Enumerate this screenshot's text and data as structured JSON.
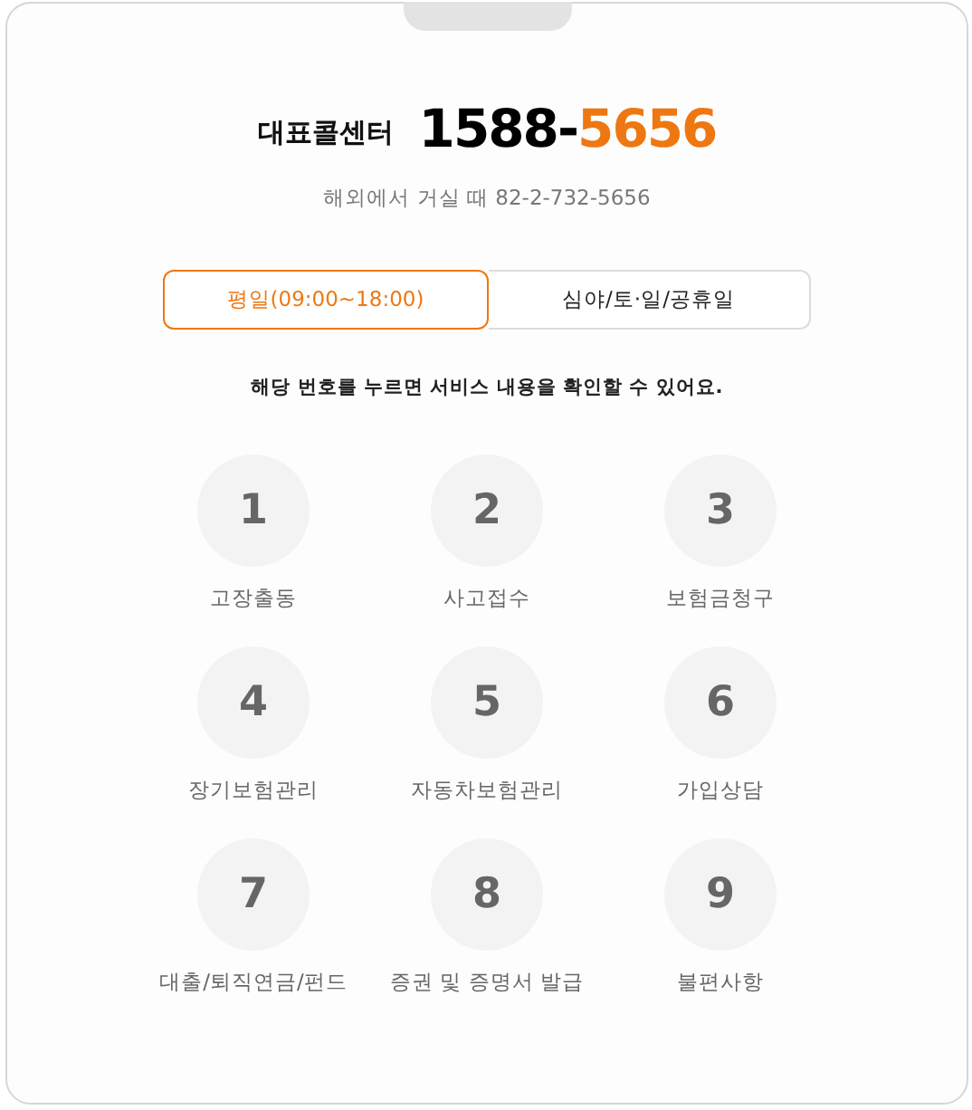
{
  "header": {
    "label": "대표콜센터",
    "number_main": "1588-",
    "number_highlight": "5656",
    "overseas": "해외에서 거실 때 82-2-732-5656"
  },
  "tabs": [
    {
      "label": "평일(09:00~18:00)",
      "selected": true
    },
    {
      "label": "심야/토·일/공휴일",
      "selected": false
    }
  ],
  "notice": "해당 번호를 누르면 서비스 내용을 확인할 수 있어요.",
  "keys": [
    {
      "digit": "1",
      "label": "고장출동"
    },
    {
      "digit": "2",
      "label": "사고접수"
    },
    {
      "digit": "3",
      "label": "보험금청구"
    },
    {
      "digit": "4",
      "label": "장기보험관리"
    },
    {
      "digit": "5",
      "label": "자동차보험관리"
    },
    {
      "digit": "6",
      "label": "가입상담"
    },
    {
      "digit": "7",
      "label": "대출/퇴직연금/펀드"
    },
    {
      "digit": "8",
      "label": "증권 및 증명서 발급"
    },
    {
      "digit": "9",
      "label": "불편사항"
    }
  ]
}
